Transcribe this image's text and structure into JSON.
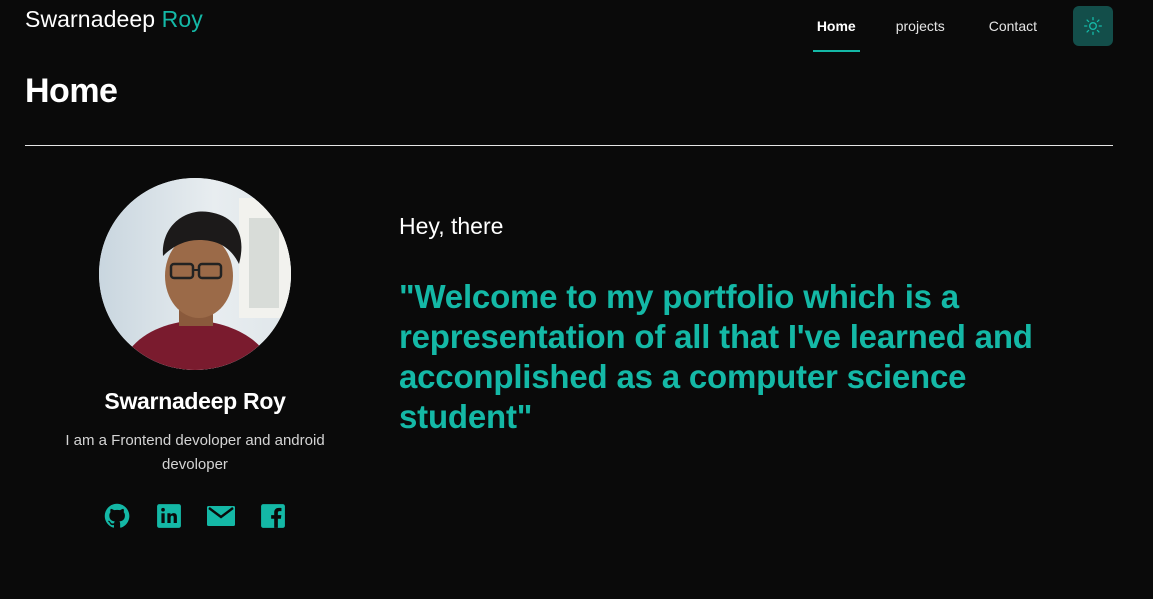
{
  "header": {
    "brand_first": "Swarnadeep",
    "brand_last": "Roy",
    "nav": [
      {
        "label": "Home",
        "active": true
      },
      {
        "label": "projects",
        "active": false
      },
      {
        "label": "Contact",
        "active": false
      }
    ],
    "theme_toggle_icon": "sun-icon"
  },
  "page": {
    "title": "Home"
  },
  "profile": {
    "name": "Swarnadeep Roy",
    "bio": "I am a Frontend devoloper and android devoloper",
    "socials": [
      {
        "icon": "github-icon"
      },
      {
        "icon": "linkedin-icon"
      },
      {
        "icon": "mail-icon"
      },
      {
        "icon": "facebook-icon"
      }
    ]
  },
  "intro": {
    "greeting": "Hey, there",
    "quote": "\"Welcome to my portfolio which is a representation of all that I've learned and acconplished as a computer science student\""
  },
  "colors": {
    "accent": "#14b8a6",
    "background": "#0a0a0a",
    "toggle_bg": "#134e4a"
  }
}
